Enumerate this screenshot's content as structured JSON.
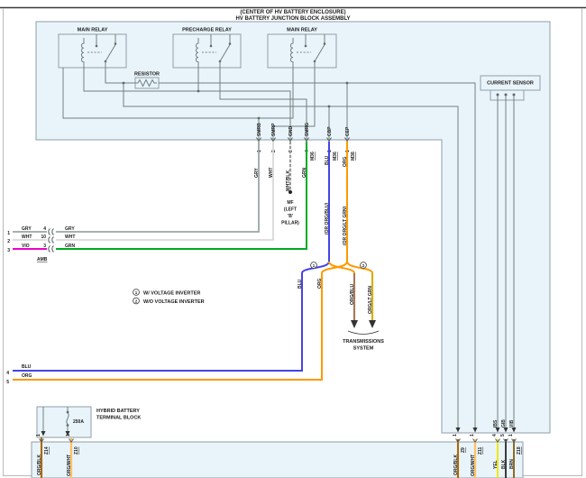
{
  "page": {
    "title_line1": "(CENTER OF HV BATTERY ENCLOSURE)",
    "title_line2": "HV BATTERY JUNCTION BLOCK ASSEMBLY"
  },
  "relays": {
    "relay1": "MAIN RELAY",
    "relay2": "PRECHARGE RELAY",
    "relay3": "MAIN RELAY"
  },
  "resistor": {
    "label": "RESISTOR"
  },
  "current_sensor": {
    "label": "CURRENT SENSOR",
    "pin1": "IBS",
    "pin2": "GIB",
    "pin3": "VIB"
  },
  "junction_pins": {
    "smrb": {
      "name": "SMRB",
      "pin": "1",
      "wire": "GRY"
    },
    "smrp": {
      "name": "SMRP",
      "pin": "2",
      "wire": "WHT"
    },
    "gnd": {
      "name": "GND",
      "pin": "3",
      "wire": "WHT/BLK"
    },
    "smrg": {
      "name": "SMRG",
      "pin": "4",
      "code": "M36",
      "wire": "GRN"
    },
    "cbp": {
      "name": "CBP",
      "pin": "1",
      "code": "M36",
      "wire": "BLU",
      "alt": "(OR ORG/BLU)"
    },
    "cep": {
      "name": "CEP",
      "pin": "1",
      "code": "M38",
      "wire": "ORG",
      "alt": "(OR ORG/LT GRN)"
    }
  },
  "ground_mf": {
    "line1": "MF",
    "line2": "(LEFT",
    "line3": "'B'",
    "line4": "PILLAR)"
  },
  "left_connector": {
    "code": "AMB",
    "row1": {
      "left_pin": "1",
      "left_wire": "GRY",
      "right_pin": "4",
      "right_wire": "GRY"
    },
    "row2": {
      "left_pin": "2",
      "left_wire": "WHT",
      "right_pin": "10",
      "right_wire": "WHT"
    },
    "row3": {
      "left_pin": "3",
      "left_wire": "VIO",
      "right_pin": "3",
      "right_wire": "GRN"
    }
  },
  "legend": {
    "item1_num": "1",
    "item1_text": "W/ VOLTAGE INVERTER",
    "item2_num": "2",
    "item2_text": "W/O VOLTAGE INVERTER"
  },
  "branch": {
    "opt1_num": "1",
    "opt2_num": "2",
    "wire_blu": "BLU",
    "wire_org": "ORG",
    "wire_orgblu": "ORG/BLU",
    "wire_orgltgrn": "ORG/LT GRN",
    "dest_line1": "TRANSMISSIONS",
    "dest_line2": "SYSTEM"
  },
  "bottom_left": {
    "row1_pin": "4",
    "row1_wire": "BLU",
    "row2_pin": "5",
    "row2_wire": "ORG"
  },
  "fuse_block": {
    "label_line1": "HYBRID BATTERY",
    "label_line2": "TERMINAL BLOCK",
    "rating": "250A"
  },
  "bottom_connectors": {
    "c1": {
      "pin": "1",
      "code": "Z14",
      "wire": "ORG/BLK"
    },
    "c2": {
      "pin": "1",
      "code": "Z10",
      "wire": "ORG/WHT"
    },
    "c3": {
      "pin": "1",
      "code": "Z9",
      "wire": "ORG/BLK"
    },
    "c4": {
      "pin": "1",
      "code": "Z11",
      "wire": "ORG/WHT"
    },
    "c5": {
      "pin": "4",
      "wire": "YEL"
    },
    "c6": {
      "pin": "5",
      "wire": "BLK"
    },
    "c7": {
      "pin": "1",
      "code": "Z18",
      "wire": "BRN"
    }
  },
  "colors": {
    "box_fill": "#e9f4fa",
    "gry": "#9aa6a6",
    "wht": "#d9d9d9",
    "wht_base": "#e6e6e6",
    "grn": "#00aa22",
    "blu": "#4444e8",
    "org": "#ff9900",
    "vio": "#ee00cc",
    "yel": "#f0e713",
    "blk": "#3c3c3c",
    "brn": "#8d6b28",
    "stripe_blk": "#222222",
    "stripe_wht": "#ffffff",
    "stripe_blu": "#3b4be0",
    "stripe_ltgrn": "#9ccc33"
  }
}
